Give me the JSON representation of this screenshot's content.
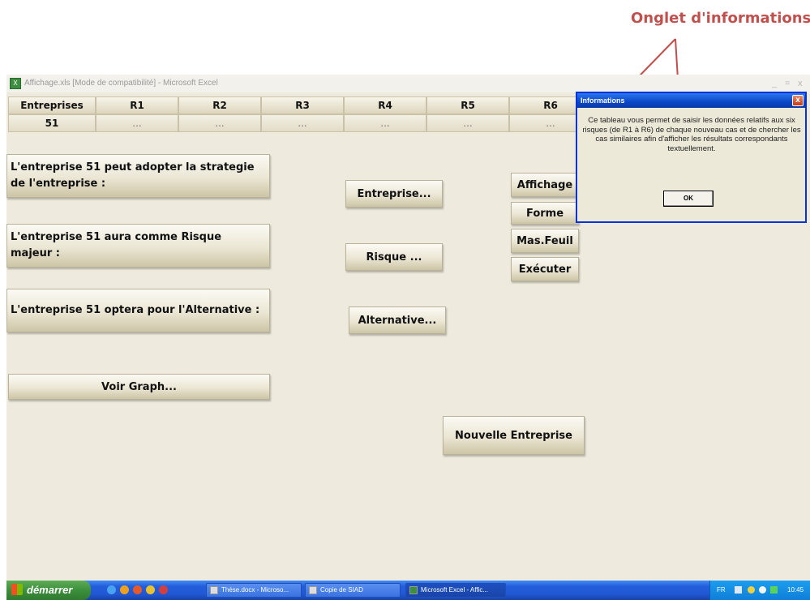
{
  "annotation": "Onglet d'informations",
  "window": {
    "title": "Affichage.xls [Mode de compatibilité] - Microsoft Excel",
    "app_icon": "excel-icon",
    "controls": [
      "_",
      "=",
      "x"
    ]
  },
  "table": {
    "headers": [
      "Entreprises",
      "R1",
      "R2",
      "R3",
      "R4",
      "R5",
      "R6"
    ],
    "values": [
      "51",
      "...",
      "...",
      "...",
      "...",
      "...",
      "..."
    ]
  },
  "statements": {
    "strategy": "L'entreprise 51 peut adopter la strategie de l'entreprise :",
    "risk": "L'entreprise 51 aura comme Risque majeur :",
    "alternative": "L'entreprise 51 optera pour l'Alternative :"
  },
  "buttons": {
    "entreprise": "Entreprise...",
    "risque": "Risque ...",
    "alternative": "Alternative...",
    "voir_graph": "Voir Graph...",
    "nouvelle": "Nouvelle Entreprise",
    "affichage": "Affichage",
    "forme": "Forme",
    "mas_feuil": "Mas.Feuil",
    "executer": "Exécuter"
  },
  "icons": {
    "info": "i",
    "undo": "U"
  },
  "dialog": {
    "title": "Informations",
    "message": "Ce tableau vous permet de saisir les données relatifs aux six risques (de R1 à R6) de chaque nouveau cas et de chercher les cas similaires afin d'afficher les résultats correspondants textuellement.",
    "ok": "OK",
    "close": "x"
  },
  "taskbar": {
    "start": "démarrer",
    "tasks": [
      "Thèse.docx - Microso...",
      "Copie de SIAD",
      "Microsoft Excel - Affic..."
    ],
    "tray": [
      "FR",
      "10:45"
    ]
  },
  "colors": {
    "annotation": "#c0504d",
    "window_bg": "#eeeadd",
    "dialog_title": "#0a46c8",
    "taskbar": "#245edb"
  }
}
